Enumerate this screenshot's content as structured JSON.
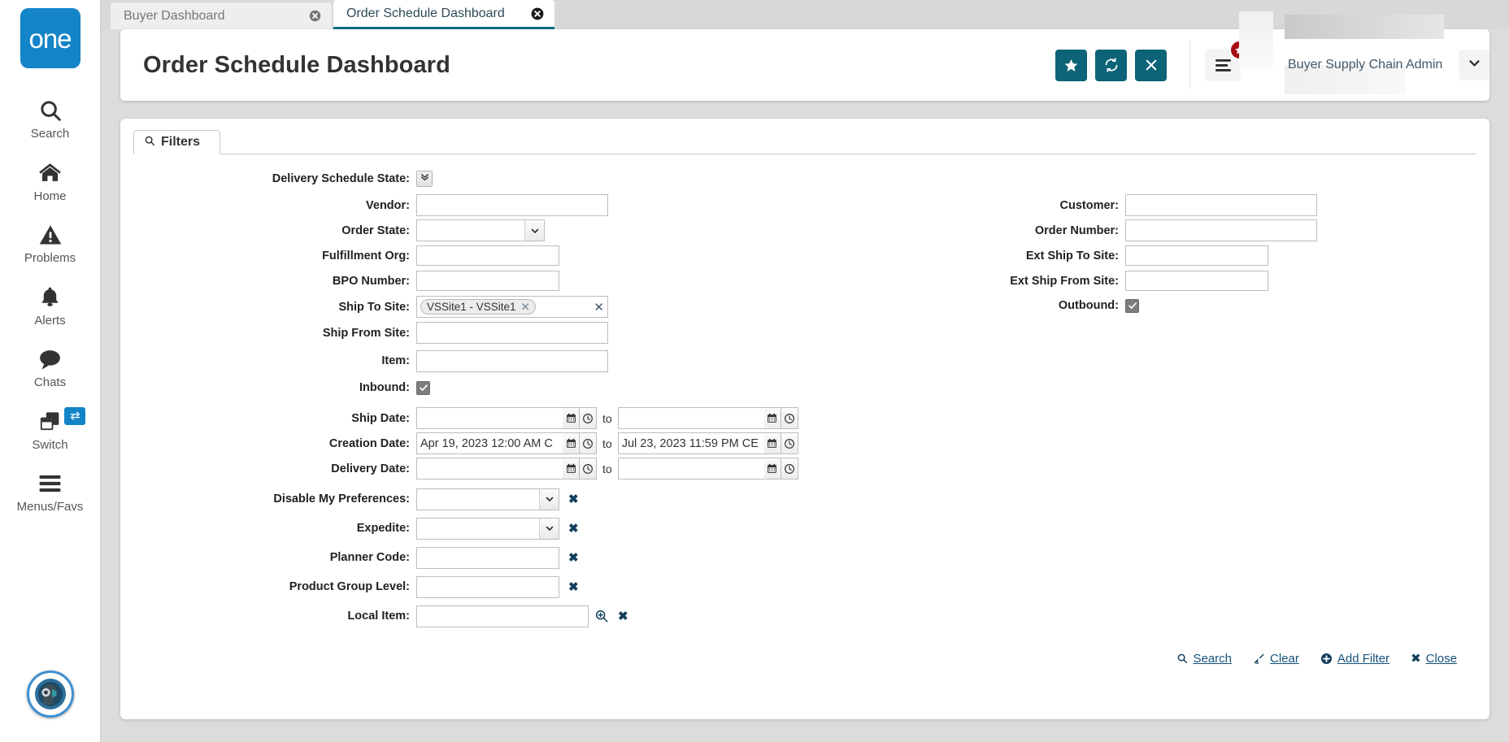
{
  "brand": {
    "logo_text": "one",
    "logo_color": "#1484c8"
  },
  "sidebar": {
    "items": [
      {
        "label": "Search",
        "icon": "search-icon"
      },
      {
        "label": "Home",
        "icon": "home-icon"
      },
      {
        "label": "Problems",
        "icon": "warning-icon"
      },
      {
        "label": "Alerts",
        "icon": "bell-icon"
      },
      {
        "label": "Chats",
        "icon": "chat-icon"
      },
      {
        "label": "Switch",
        "icon": "switch-icon"
      },
      {
        "label": "Menus/Favs",
        "icon": "hamburger-icon"
      }
    ]
  },
  "tabs": [
    {
      "label": "Buyer Dashboard",
      "active": false
    },
    {
      "label": "Order Schedule Dashboard",
      "active": true
    }
  ],
  "header": {
    "title": "Order Schedule Dashboard",
    "buttons": [
      {
        "name": "favorite-button",
        "icon": "star-icon"
      },
      {
        "name": "refresh-button",
        "icon": "refresh-icon"
      },
      {
        "name": "close-button",
        "icon": "x-icon"
      }
    ],
    "menu_icon": "menu-icon",
    "menu_badge_icon": "star-icon",
    "user_name": "Buyer Supply Chain Admin",
    "user_caret_icon": "chevron-down-icon",
    "accent_color": "#0d6377"
  },
  "panel": {
    "tab_label": "Filters",
    "tab_icon": "search-icon"
  },
  "filters": {
    "delivery_schedule_state": {
      "label": "Delivery Schedule State:",
      "expand_icon": "double-chevron-down-icon"
    },
    "left": [
      {
        "label": "Vendor:",
        "type": "text",
        "value": ""
      },
      {
        "label": "Order State:",
        "type": "select",
        "value": ""
      },
      {
        "label": "Fulfillment Org:",
        "type": "text",
        "value": ""
      },
      {
        "label": "BPO Number:",
        "type": "text",
        "value": ""
      },
      {
        "label": "Ship To Site:",
        "type": "chips",
        "chips": [
          "VSSite1 - VSSite1"
        ]
      },
      {
        "label": "Ship From Site:",
        "type": "text",
        "value": ""
      },
      {
        "label": "Item:",
        "type": "text",
        "value": ""
      },
      {
        "label": "Inbound:",
        "type": "checkbox",
        "checked": true
      }
    ],
    "right": [
      {
        "label": "Customer:",
        "type": "text",
        "value": ""
      },
      {
        "label": "Order Number:",
        "type": "text",
        "value": ""
      },
      {
        "label": "Ext Ship To Site:",
        "type": "text",
        "value": ""
      },
      {
        "label": "Ext Ship From Site:",
        "type": "text",
        "value": ""
      },
      {
        "label": "Outbound:",
        "type": "checkbox",
        "checked": true
      }
    ],
    "dates": [
      {
        "label": "Ship Date:",
        "from": "",
        "to": ""
      },
      {
        "label": "Creation Date:",
        "from": "Apr 19, 2023 12:00 AM C",
        "to": "Jul 23, 2023 11:59 PM CE"
      },
      {
        "label": "Delivery Date:",
        "from": "",
        "to": ""
      }
    ],
    "to_label": "to",
    "extra": [
      {
        "label": "Disable My Preferences:",
        "type": "select",
        "value": "",
        "remove_icon": "x-icon"
      },
      {
        "label": "Expedite:",
        "type": "select",
        "value": "",
        "remove_icon": "x-icon"
      },
      {
        "label": "Planner Code:",
        "type": "text",
        "value": "",
        "remove_icon": "x-icon"
      },
      {
        "label": "Product Group Level:",
        "type": "text",
        "value": "",
        "remove_icon": "x-icon"
      },
      {
        "label": "Local Item:",
        "type": "text",
        "value": "",
        "lookup_icon": "magnifier-plus-icon",
        "remove_icon": "x-icon"
      }
    ]
  },
  "actions": [
    {
      "label": "Search",
      "icon": "search-icon"
    },
    {
      "label": "Clear",
      "icon": "broom-icon"
    },
    {
      "label": "Add Filter",
      "icon": "plus-circle-icon"
    },
    {
      "label": "Close",
      "icon": "x-icon"
    }
  ]
}
